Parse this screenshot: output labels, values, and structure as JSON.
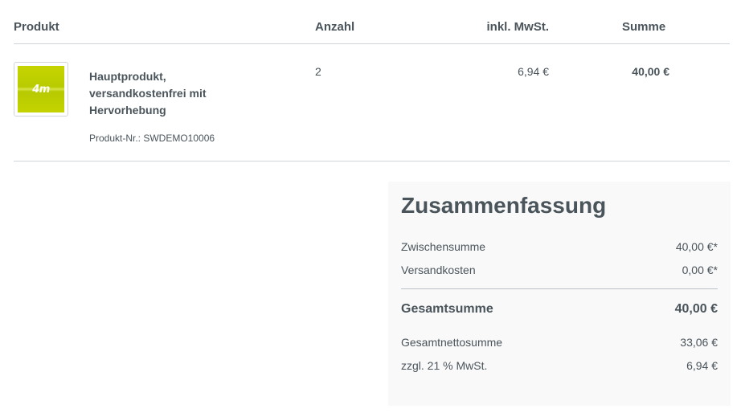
{
  "table": {
    "headers": {
      "product": "Produkt",
      "quantity": "Anzahl",
      "tax": "inkl. MwSt.",
      "sum": "Summe"
    }
  },
  "line_item": {
    "image_logo_text": "4m",
    "name": "Hauptprodukt, versandkostenfrei mit Hervorhebung",
    "product_number": "Produkt-Nr.: SWDEMO10006",
    "quantity": "2",
    "tax": "6,94 €",
    "sum": "40,00 €"
  },
  "summary": {
    "title": "Zusammenfassung",
    "subtotal_label": "Zwischensumme",
    "subtotal_value": "40,00 €*",
    "shipping_label": "Versandkosten",
    "shipping_value": "0,00 €*",
    "total_label": "Gesamtsumme",
    "total_value": "40,00 €",
    "net_label": "Gesamtnettosumme",
    "net_value": "33,06 €",
    "vat_label": "zzgl. 21 % MwSt.",
    "vat_value": "6,94 €"
  },
  "colors": {
    "text": "#4a545b",
    "border": "#d1d5d9",
    "summary_bg": "#f9f9f9",
    "product_image": "#c6d400"
  }
}
